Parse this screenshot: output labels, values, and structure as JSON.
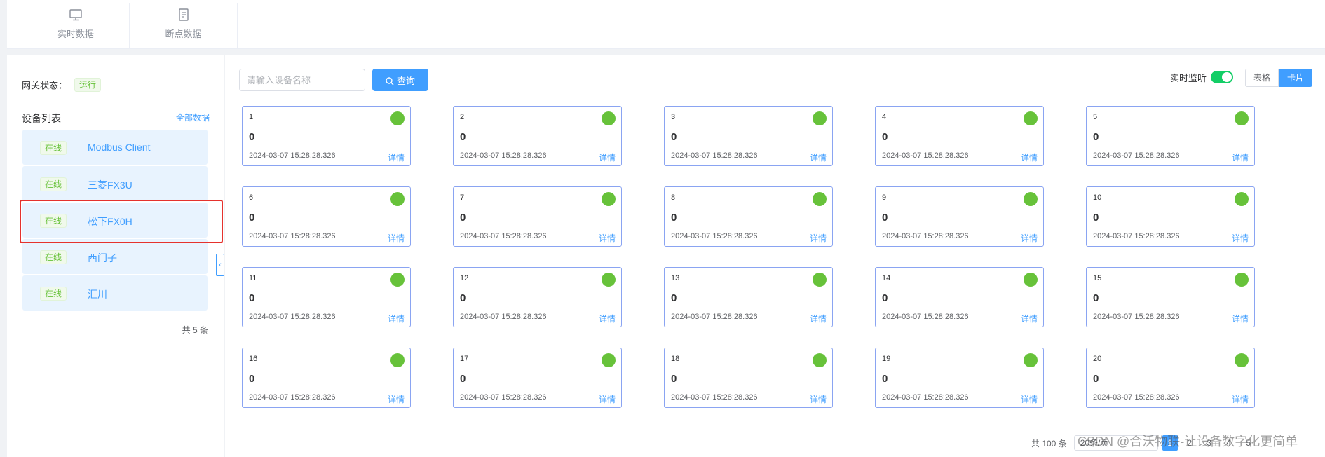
{
  "top_tabs": [
    {
      "label": "实时数据",
      "icon": "monitor-icon"
    },
    {
      "label": "断点数据",
      "icon": "document-icon"
    }
  ],
  "gateway": {
    "label": "网关状态：",
    "status": "运行"
  },
  "device_list": {
    "title": "设备列表",
    "all_link": "全部数据",
    "items": [
      {
        "status": "在线",
        "name": "Modbus Client"
      },
      {
        "status": "在线",
        "name": "三菱FX3U"
      },
      {
        "status": "在线",
        "name": "松下FX0H"
      },
      {
        "status": "在线",
        "name": "西门子"
      },
      {
        "status": "在线",
        "name": "汇川"
      }
    ],
    "total": "共 5 条"
  },
  "toolbar": {
    "search_placeholder": "请输入设备名称",
    "query_label": "查询",
    "monitor_label": "实时监听",
    "view_table": "表格",
    "view_card": "卡片"
  },
  "cards": [
    {
      "no": "1",
      "value": "0",
      "time": "2024-03-07 15:28:28.326",
      "detail": "详情"
    },
    {
      "no": "2",
      "value": "0",
      "time": "2024-03-07 15:28:28.326",
      "detail": "详情"
    },
    {
      "no": "3",
      "value": "0",
      "time": "2024-03-07 15:28:28.326",
      "detail": "详情"
    },
    {
      "no": "4",
      "value": "0",
      "time": "2024-03-07 15:28:28.326",
      "detail": "详情"
    },
    {
      "no": "5",
      "value": "0",
      "time": "2024-03-07 15:28:28.326",
      "detail": "详情"
    },
    {
      "no": "6",
      "value": "0",
      "time": "2024-03-07 15:28:28.326",
      "detail": "详情"
    },
    {
      "no": "7",
      "value": "0",
      "time": "2024-03-07 15:28:28.326",
      "detail": "详情"
    },
    {
      "no": "8",
      "value": "0",
      "time": "2024-03-07 15:28:28.326",
      "detail": "详情"
    },
    {
      "no": "9",
      "value": "0",
      "time": "2024-03-07 15:28:28.326",
      "detail": "详情"
    },
    {
      "no": "10",
      "value": "0",
      "time": "2024-03-07 15:28:28.326",
      "detail": "详情"
    },
    {
      "no": "11",
      "value": "0",
      "time": "2024-03-07 15:28:28.326",
      "detail": "详情"
    },
    {
      "no": "12",
      "value": "0",
      "time": "2024-03-07 15:28:28.326",
      "detail": "详情"
    },
    {
      "no": "13",
      "value": "0",
      "time": "2024-03-07 15:28:28.326",
      "detail": "详情"
    },
    {
      "no": "14",
      "value": "0",
      "time": "2024-03-07 15:28:28.326",
      "detail": "详情"
    },
    {
      "no": "15",
      "value": "0",
      "time": "2024-03-07 15:28:28.326",
      "detail": "详情"
    },
    {
      "no": "16",
      "value": "0",
      "time": "2024-03-07 15:28:28.326",
      "detail": "详情"
    },
    {
      "no": "17",
      "value": "0",
      "time": "2024-03-07 15:28:28.326",
      "detail": "详情"
    },
    {
      "no": "18",
      "value": "0",
      "time": "2024-03-07 15:28:28.326",
      "detail": "详情"
    },
    {
      "no": "19",
      "value": "0",
      "time": "2024-03-07 15:28:28.326",
      "detail": "详情"
    },
    {
      "no": "20",
      "value": "0",
      "time": "2024-03-07 15:28:28.326",
      "detail": "详情"
    }
  ],
  "pagination": {
    "total": "共 100 条",
    "page_size": "20条/页",
    "pages": [
      "1",
      "2",
      "3",
      "4",
      "5"
    ],
    "current": "1"
  },
  "watermark": "CSDN @合沃物联-让设备数字化更简单",
  "colors": {
    "accent": "#409eff",
    "online": "#67c23a",
    "card_border": "#8aa4f2",
    "highlight": "#e5322d"
  }
}
